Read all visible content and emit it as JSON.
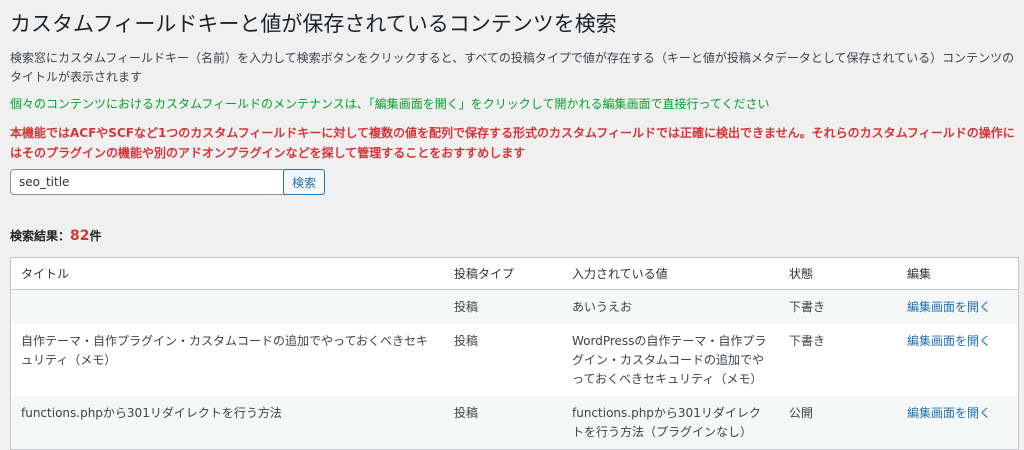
{
  "page": {
    "title": "カスタムフィールドキーと値が保存されているコンテンツを検索",
    "description": "検索窓にカスタムフィールドキー（名前）を入力して検索ボタンをクリックすると、すべての投稿タイプで値が存在する（キーと値が投稿メタデータとして保存されている）コンテンツのタイトルが表示されます",
    "note_green": "個々のコンテンツにおけるカスタムフィールドのメンテナンスは、「編集画面を開く」をクリックして開かれる編集画面で直接行ってください",
    "note_red": "本機能ではACFやSCFなど1つのカスタムフィールドキーに対して複数の値を配列で保存する形式のカスタムフィールドでは正確に検出できません。それらのカスタムフィールドの操作にはそのプラグインの機能や別のアドオンプラグインなどを探して管理することをおすすめします"
  },
  "search": {
    "value": "seo_title",
    "button_label": "検索"
  },
  "result": {
    "label": "検索結果：",
    "count": "82",
    "unit": "件"
  },
  "table": {
    "headers": [
      "タイトル",
      "投稿タイプ",
      "入力されている値",
      "状態",
      "編集"
    ],
    "rows": [
      {
        "title": "",
        "type": "投稿",
        "value": "あいうえお",
        "status": "下書き",
        "edit": "編集画面を開く"
      },
      {
        "title": "自作テーマ・自作プラグイン・カスタムコードの追加でやっておくべきセキュリティ（メモ）",
        "type": "投稿",
        "value": "WordPressの自作テーマ・自作プラグイン・カスタムコードの追加でやっておくべきセキュリティ（メモ）",
        "status": "下書き",
        "edit": "編集画面を開く"
      },
      {
        "title": "functions.phpから301リダイレクトを行う方法",
        "type": "投稿",
        "value": "functions.phpから301リダイレクトを行う方法（プラグインなし）",
        "status": "公開",
        "edit": "編集画面を開く"
      }
    ]
  },
  "colors": {
    "accent": "#2271b1",
    "success": "#00a32a",
    "danger": "#d63638",
    "background": "#f0f0f1"
  }
}
